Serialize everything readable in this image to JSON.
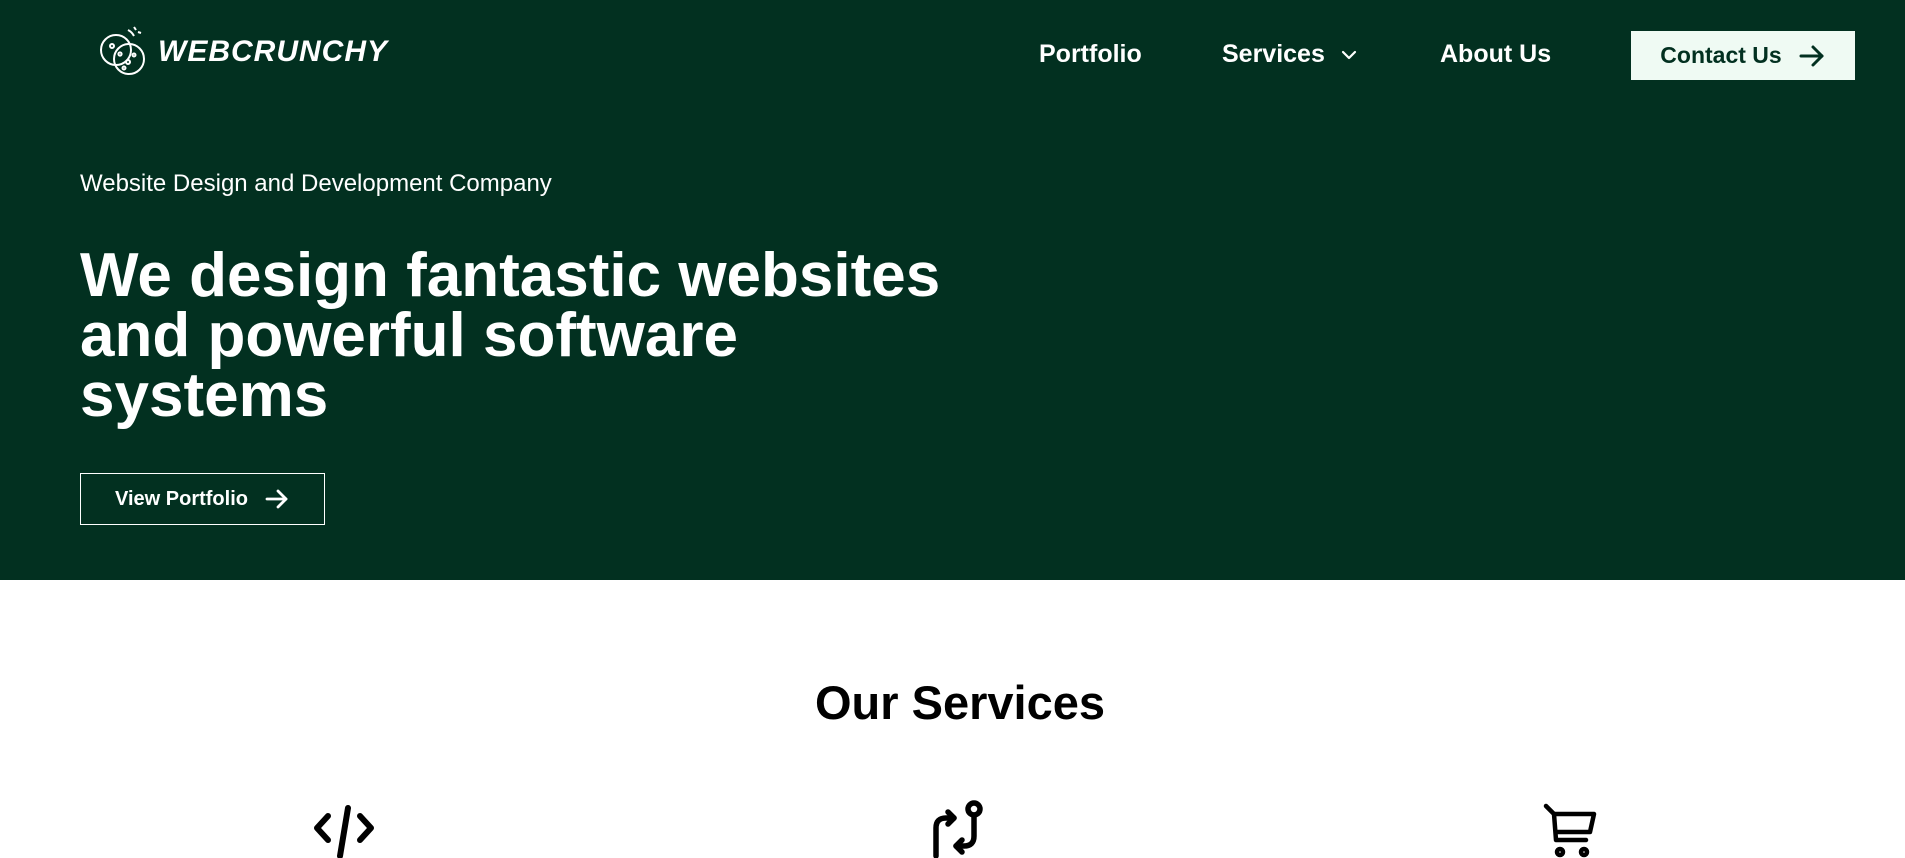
{
  "brand": {
    "name": "WEBCRUNCHY",
    "logo_icon": "cookie-logo-icon"
  },
  "nav": {
    "items": [
      {
        "label": "Portfolio"
      },
      {
        "label": "Services",
        "icon": "chevron-down-icon"
      },
      {
        "label": "About Us"
      }
    ],
    "contact_label": "Contact Us",
    "contact_icon": "arrow-right-icon"
  },
  "hero": {
    "subheading": "Website Design and Development Company",
    "headline": "We design fantastic websites and powerful software systems",
    "cta_label": "View Portfolio",
    "cta_icon": "arrow-right-icon"
  },
  "services": {
    "title": "Our Services",
    "icons": [
      "code-icon",
      "git-pull-request-icon",
      "shopping-cart-icon"
    ]
  },
  "colors": {
    "hero_background": "#023020",
    "contact_button_background": "#effaf3",
    "text_light": "#ffffff",
    "text_dark": "#000000"
  }
}
